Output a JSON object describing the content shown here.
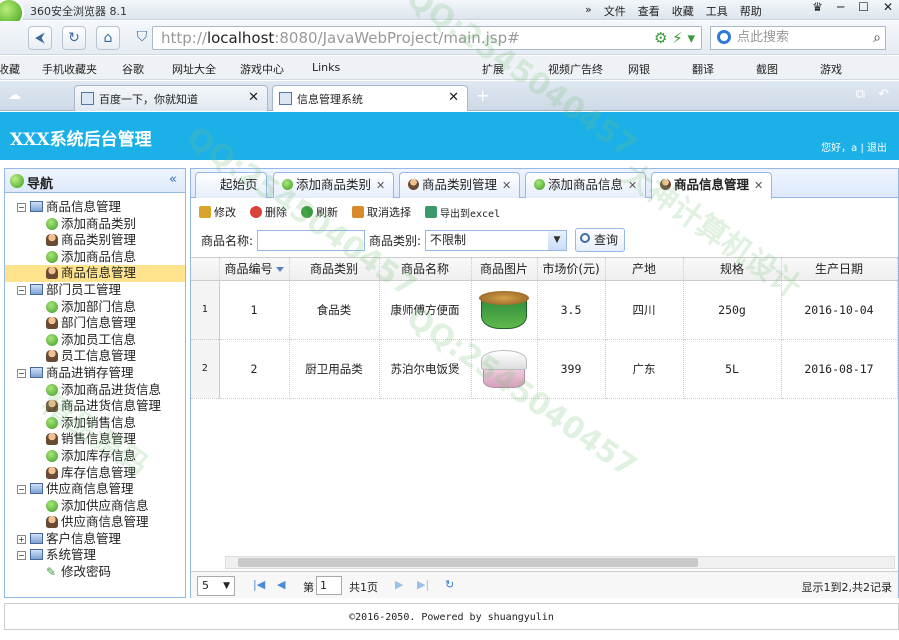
{
  "browser": {
    "title": "360安全浏览器 8.1",
    "menu": [
      "»",
      "文件",
      "查看",
      "收藏",
      "工具",
      "帮助"
    ],
    "url_prefix": "http://",
    "url_host": "localhost",
    "url_rest": ":8080/JavaWebProject/main.jsp#",
    "search_placeholder": "点此搜索",
    "favorites": [
      "收藏",
      "手机收藏夹",
      "谷歌",
      "网址大全",
      "游戏中心",
      "Links",
      "扩展",
      "视频广告终",
      "网银",
      "翻译",
      "截图",
      "游戏"
    ],
    "tabs": [
      {
        "label": "百度一下，你就知道"
      },
      {
        "label": "信息管理系统"
      }
    ],
    "new_tab": "+"
  },
  "app": {
    "title": "XXX系统后台管理",
    "user_text": "您好，a | 退出"
  },
  "sidebar": {
    "title": "导航",
    "collapse": "«",
    "groups": [
      {
        "label": "商品信息管理",
        "items": [
          {
            "label": "添加商品类别",
            "icon": "add"
          },
          {
            "label": "商品类别管理",
            "icon": "user"
          },
          {
            "label": "添加商品信息",
            "icon": "add"
          },
          {
            "label": "商品信息管理",
            "icon": "user",
            "selected": true
          }
        ]
      },
      {
        "label": "部门员工管理",
        "items": [
          {
            "label": "添加部门信息",
            "icon": "add"
          },
          {
            "label": "部门信息管理",
            "icon": "user"
          },
          {
            "label": "添加员工信息",
            "icon": "add"
          },
          {
            "label": "员工信息管理",
            "icon": "user"
          }
        ]
      },
      {
        "label": "商品进销存管理",
        "items": [
          {
            "label": "添加商品进货信息",
            "icon": "add"
          },
          {
            "label": "商品进货信息管理",
            "icon": "user"
          },
          {
            "label": "添加销售信息",
            "icon": "add"
          },
          {
            "label": "销售信息管理",
            "icon": "user"
          },
          {
            "label": "添加库存信息",
            "icon": "add"
          },
          {
            "label": "库存信息管理",
            "icon": "user"
          }
        ]
      },
      {
        "label": "供应商信息管理",
        "items": [
          {
            "label": "添加供应商信息",
            "icon": "add"
          },
          {
            "label": "供应商信息管理",
            "icon": "user"
          }
        ]
      },
      {
        "label": "客户信息管理",
        "collapsed": true,
        "items": []
      },
      {
        "label": "系统管理",
        "items": [
          {
            "label": "修改密码",
            "icon": "pencil"
          }
        ]
      }
    ]
  },
  "content_tabs": [
    {
      "label": "起始页",
      "closable": false
    },
    {
      "label": "添加商品类别",
      "closable": true
    },
    {
      "label": "商品类别管理",
      "closable": true
    },
    {
      "label": "添加商品信息",
      "closable": true
    },
    {
      "label": "商品信息管理",
      "closable": true,
      "active": true
    }
  ],
  "toolbar": [
    {
      "label": "修改",
      "color": "#d9a42a"
    },
    {
      "label": "删除",
      "color": "#d9423a"
    },
    {
      "label": "刷新",
      "color": "#3b9a3b"
    },
    {
      "label": "取消选择",
      "color": "#d98a2a"
    },
    {
      "label": "导出到excel",
      "color": "#3b9a6b"
    }
  ],
  "filter": {
    "name_label": "商品名称:",
    "name_value": "",
    "type_label": "商品类别:",
    "type_value": "不限制",
    "query_label": "查询"
  },
  "grid": {
    "columns": [
      "商品编号",
      "商品类别",
      "商品名称",
      "商品图片",
      "市场价(元)",
      "产地",
      "规格",
      "生产日期"
    ],
    "rows": [
      {
        "rownum": "1",
        "id": "1",
        "type": "食品类",
        "name": "康师傅方便面",
        "image": "noodle-bowl",
        "price": "3.5",
        "origin": "四川",
        "spec": "250g",
        "date": "2016-10-04"
      },
      {
        "rownum": "2",
        "id": "2",
        "type": "厨卫用品类",
        "name": "苏泊尔电饭煲",
        "image": "rice-cooker",
        "price": "399",
        "origin": "广东",
        "spec": "5L",
        "date": "2016-08-17"
      }
    ]
  },
  "pager": {
    "page_size": "5",
    "page_prefix": "第",
    "page_value": "1",
    "page_total": "共1页",
    "info": "显示1到2,共2记录"
  },
  "footer": "©2016-2050. Powered by shuangyulin"
}
